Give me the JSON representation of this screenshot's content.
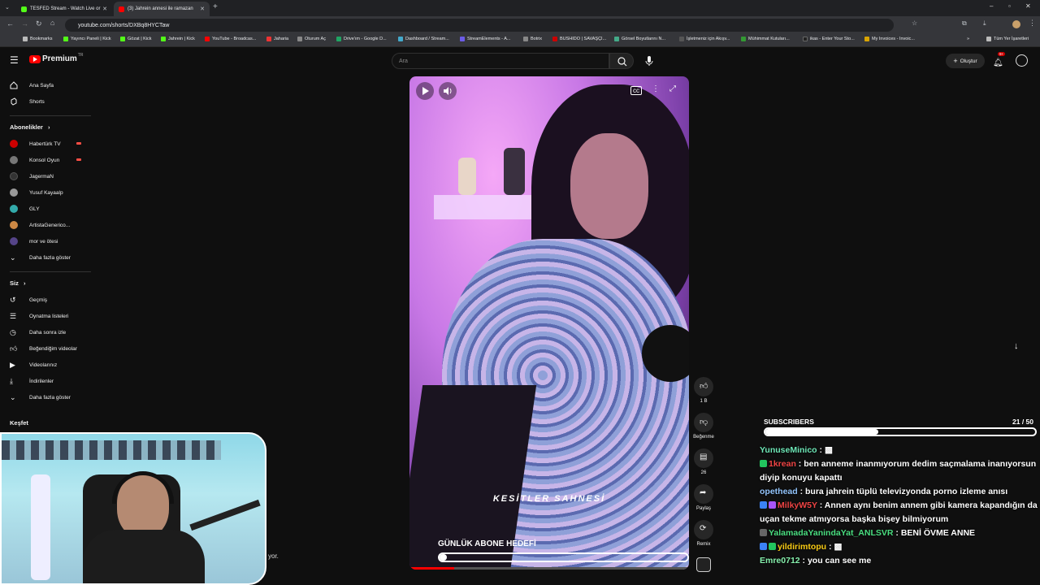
{
  "browser": {
    "tabs": [
      {
        "title": "TESFED Stream - Watch Live or",
        "favicon_color": "#53fc18"
      },
      {
        "title": "(3) Jahrein annesi ile ramazan",
        "favicon_color": "#ff0000"
      }
    ],
    "url": "youtube.com/shorts/DXBq8HYCTaw",
    "bookmarks": [
      {
        "label": "Bookmarks",
        "color": "#bbbbbb"
      },
      {
        "label": "Yayıncı Paneli | Kick",
        "color": "#53fc18"
      },
      {
        "label": "Gözat | Kick",
        "color": "#53fc18"
      },
      {
        "label": "Jahrein | Kick",
        "color": "#53fc18"
      },
      {
        "label": "YouTube - Broadcas...",
        "color": "#ff0000"
      },
      {
        "label": "Jaharia",
        "color": "#e33"
      },
      {
        "label": "Oturum Aç",
        "color": "#888"
      },
      {
        "label": "Drive'ım - Google D...",
        "color": "#1fa463"
      },
      {
        "label": "Dashboard / Stream...",
        "color": "#4ac"
      },
      {
        "label": "StreamElements - A...",
        "color": "#6c5ce7"
      },
      {
        "label": "Botrix",
        "color": "#888"
      },
      {
        "label": "BUSHIDO | SAVAŞÇI...",
        "color": "#c00"
      },
      {
        "label": "Görsel Boyutlarını N...",
        "color": "#4a8"
      },
      {
        "label": "İşletmeniz için Akışv...",
        "color": "#555"
      },
      {
        "label": "Mühimmat Kutuları...",
        "color": "#393"
      },
      {
        "label": "ikas - Enter Your Sto...",
        "color": "#222"
      },
      {
        "label": "My Invoices - Invoic...",
        "color": "#d9a400"
      }
    ],
    "all_bookmarks": "Tüm Yer İşaretleri"
  },
  "youtube": {
    "logo": "Premium",
    "logo_sup": "TR",
    "search_placeholder": "Ara",
    "create_label": "Oluştur",
    "notif_count": "9+",
    "sidebar": {
      "home": "Ana Sayfa",
      "shorts": "Shorts",
      "subscriptions_head": "Abonelikler",
      "channels": [
        {
          "name": "Habertürk TV",
          "color": "#c00",
          "live": true
        },
        {
          "name": "Konsol Oyun",
          "color": "#777",
          "live": true
        },
        {
          "name": "JagermaN",
          "color": "#333",
          "live": false
        },
        {
          "name": "Yusuf Kayaalp",
          "color": "#999",
          "live": false
        },
        {
          "name": "GLY",
          "color": "#3aa",
          "live": false
        },
        {
          "name": "ArtistaGenerico...",
          "color": "#c84",
          "live": false
        },
        {
          "name": "mor ve ötesi",
          "color": "#548",
          "live": false
        }
      ],
      "show_more": "Daha fazla göster",
      "you_head": "Siz",
      "you_items": [
        "Geçmiş",
        "Oynatma listeleri",
        "Daha sonra izle",
        "Beğendiğim videolar",
        "Videolarınız",
        "İndirilenler"
      ],
      "you_show_more": "Daha fazla göster",
      "explore_head": "Keşfet"
    },
    "actions": {
      "likes": "1 B",
      "dislike": "Beğenme",
      "comments": "26",
      "share": "Paylaş",
      "remix": "Remix"
    }
  },
  "video": {
    "caption": "KESİTLER SAHNESİ",
    "goal_title": "GÜNLÜK ABONE HEDEFİ",
    "goal_progress": 0.0,
    "playback_progress": 0.16
  },
  "stream_overlay": {
    "subscribers_label": "SUBSCRIBERS",
    "subscribers_count": "21 / 50",
    "subscribers_progress": 0.42,
    "webcam_caption_fragment": "yor.",
    "chat": [
      {
        "user": "YunuseMinico",
        "user_color": "#6ee7b7",
        "text": "▩",
        "badges": []
      },
      {
        "user": "1krean",
        "user_color": "#ef4444",
        "text": "ben anneme inanmıyorum dedim saçmalama inanıyorsun diyip konuyu kapattı",
        "badges": [
          "#22c55e"
        ]
      },
      {
        "user": "opethead",
        "user_color": "#93c5fd",
        "text": "bura jahrein tüplü televizyonda porno izleme anısı",
        "badges": []
      },
      {
        "user": "MilkyW5Y",
        "user_color": "#ef4444",
        "text": "Annen aynı benim annem gibi kamera kapandığın da uçan tekme atmıyorsa başka bişey bilmiyorum",
        "badges": [
          "#3b82f6",
          "#a855f7"
        ]
      },
      {
        "user": "YalamadaYanindaYat_ANLSVR",
        "user_color": "#4ade80",
        "text": "BENİ ÖVME ANNE",
        "badges": [
          "#666"
        ]
      },
      {
        "user": "yildirimtopu",
        "user_color": "#facc15",
        "text": "▩",
        "badges": [
          "#3b82f6",
          "#22c55e"
        ]
      },
      {
        "user": "Emre0712",
        "user_color": "#86efac",
        "text": "you can see me",
        "badges": []
      }
    ]
  }
}
